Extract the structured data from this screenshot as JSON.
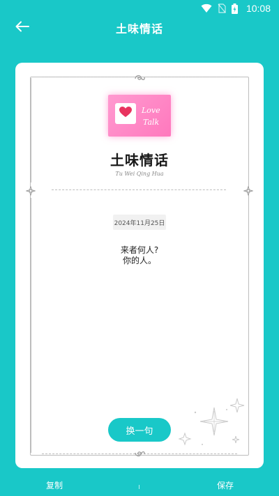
{
  "status_bar": {
    "time": "10:08"
  },
  "app_bar": {
    "title": "土味情话"
  },
  "card": {
    "stamp_text_line1": "Love",
    "stamp_text_line2": "Talk",
    "title": "土味情话",
    "subtitle": "Tu Wei Qing Hua",
    "date": "2024年11月25日",
    "quote_line1": "来者何人?",
    "quote_line2": "你的人。",
    "shuffle_label": "换一句"
  },
  "bottom_bar": {
    "copy_label": "复制",
    "save_label": "保存"
  },
  "colors": {
    "accent": "#19c8c8",
    "stamp_pink": "#ff86c6",
    "heart_red": "#e8345f"
  }
}
